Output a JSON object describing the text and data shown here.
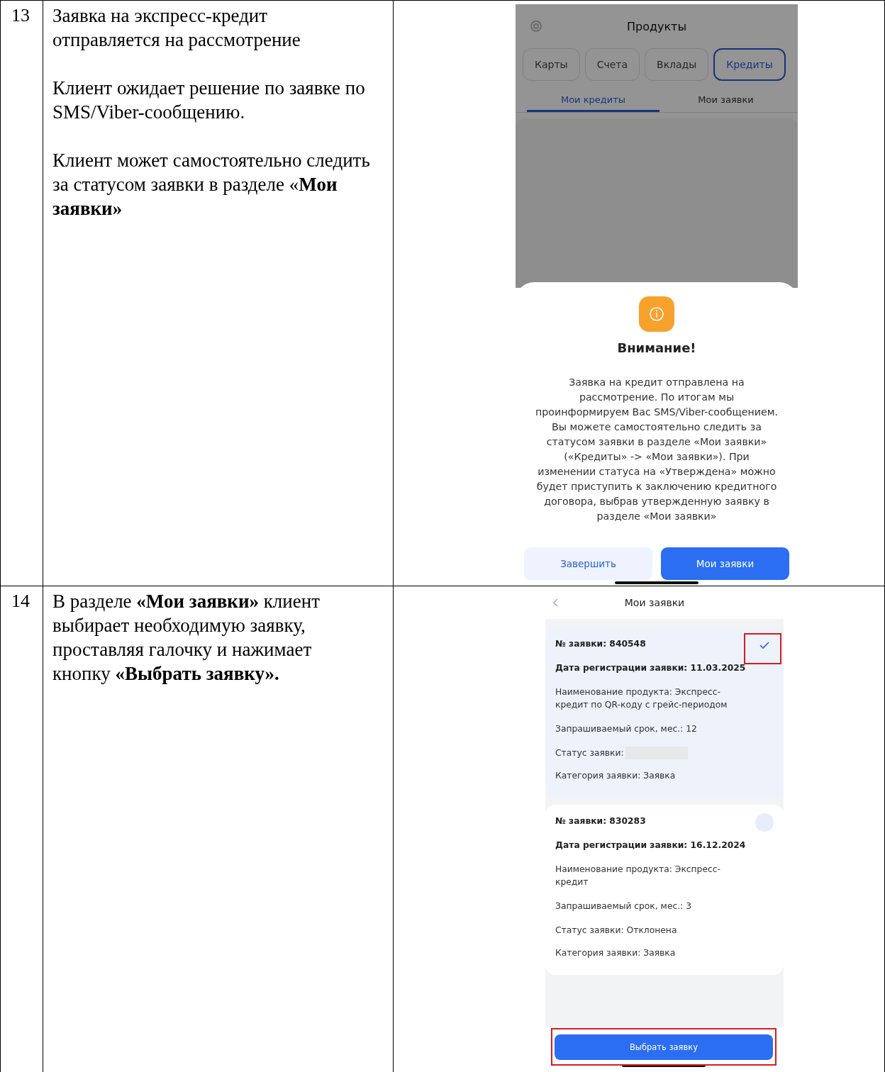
{
  "rows": [
    {
      "number": "13",
      "paragraphs": [
        "Заявка на экспресс-кредит отправляется на рассмотрение",
        "Клиент ожидает решение по заявке по SMS/Viber-сообщению.",
        "Клиент может самостоятельно следить за статусом заявки в разделе «**Мои заявки»**"
      ],
      "screen": {
        "kind": "dialog",
        "title": "Продукты",
        "dimmed": true,
        "chips": [
          {
            "label": "Карты",
            "selected": false
          },
          {
            "label": "Счета",
            "selected": false
          },
          {
            "label": "Вклады",
            "selected": false
          },
          {
            "label": "Кредиты",
            "selected": true
          }
        ],
        "subtabs": [
          {
            "label": "Мои кредиты",
            "selected": true
          },
          {
            "label": "Мои заявки",
            "selected": false
          }
        ],
        "modal": {
          "title": "Внимание!",
          "message": "Заявка на кредит отправлена на рассмотрение. По итогам мы проинформируем Вас SMS/Viber-сообщением. Вы можете самостоятельно следить за статусом заявки в разделе «Мои заявки» («Кредиты» -> «Мои заявки»). При изменении статуса на «Утверждена» можно будет приступить к заключению кредитного договора, выбрав утвержденную заявку в разделе «Мои заявки»",
          "buttons": [
            {
              "label": "Завершить",
              "kind": "secondary"
            },
            {
              "label": "Мои заявки",
              "kind": "primary"
            }
          ]
        }
      }
    },
    {
      "number": "14",
      "paragraphs": [
        "В разделе **«Мои заявки»** клиент выбирает необходимую заявку, проставляя галочку и нажимает кнопку **«Выбрать заявку».**"
      ],
      "screen": {
        "kind": "list",
        "title": "Мои заявки",
        "applications": [
          {
            "selected": true,
            "highlighted": true,
            "number": "№ заявки: 840548",
            "date": "Дата регистрации заявки: 11.03.2025",
            "product": "Наименование продукта: Экспресс-кредит по QR-коду с грейс-периодом",
            "term": "Запрашиваемый срок, мес.: 12",
            "status": {
              "text": "Статус заявки:",
              "redacted": true
            },
            "category": "Категория заявки: Заявка"
          },
          {
            "selected": false,
            "highlighted": false,
            "number": "№ заявки: 830283",
            "date": "Дата регистрации заявки: 16.12.2024",
            "product": "Наименование продукта: Экспресс-кредит",
            "term": "Запрашиваемый срок, мес.: 3",
            "status": {
              "text": "Статус заявки: Отклонена",
              "redacted": false
            },
            "category": "Категория заявки: Заявка"
          }
        ],
        "button": {
          "label": "Выбрать заявку",
          "highlighted": true
        }
      }
    }
  ]
}
